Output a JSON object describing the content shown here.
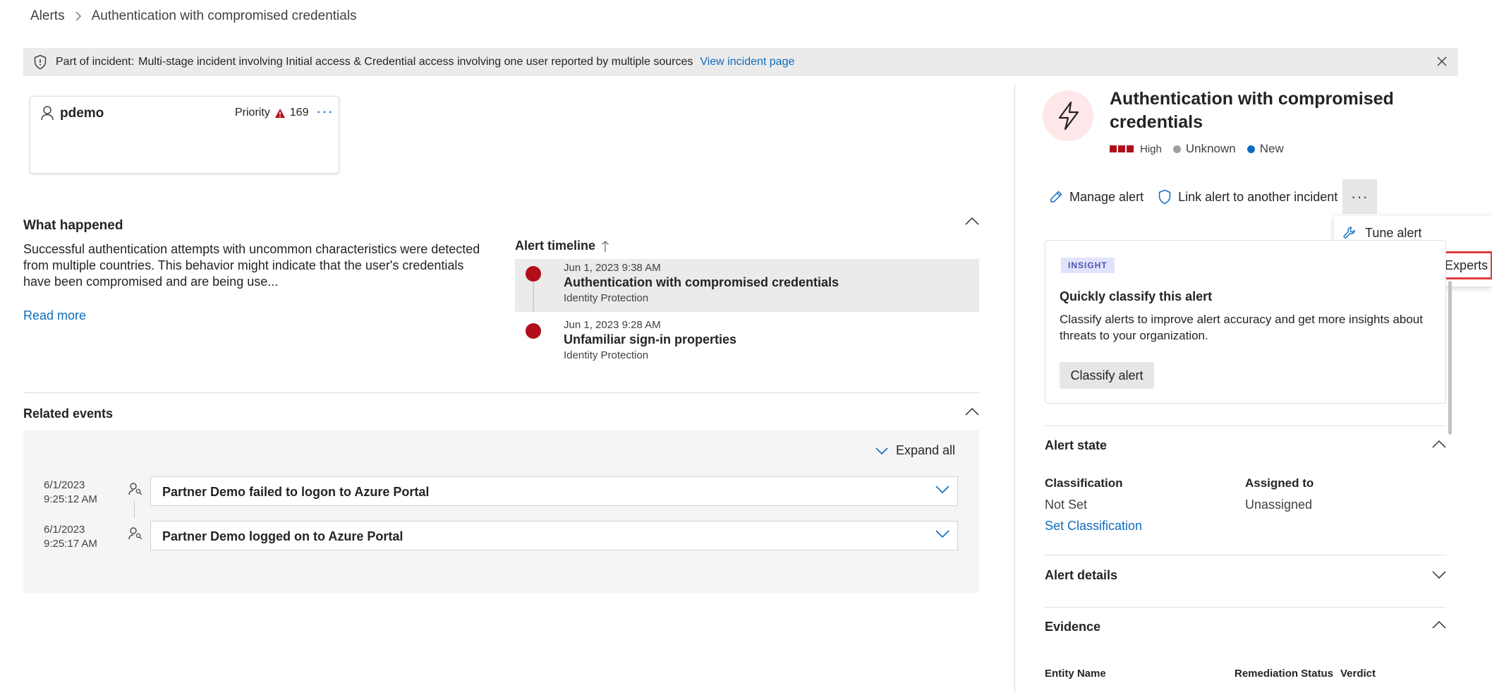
{
  "breadcrumb": {
    "root": "Alerts",
    "current": "Authentication with compromised credentials"
  },
  "banner": {
    "label": "Part of incident:",
    "description": "Multi-stage incident involving Initial access & Credential access involving one user reported by multiple sources",
    "link": "View incident page"
  },
  "user_card": {
    "name": "pdemo",
    "priority_label": "Priority",
    "priority_value": "169"
  },
  "what_happened": {
    "title": "What happened",
    "text": "Successful authentication attempts with uncommon characteristics were detected from multiple countries. This behavior might indicate that the user's credentials have been compromised and are being use...",
    "read_more": "Read more"
  },
  "timeline": {
    "title": "Alert timeline",
    "items": [
      {
        "date": "Jun 1, 2023 9:38 AM",
        "name": "Authentication with compromised credentials",
        "source": "Identity Protection"
      },
      {
        "date": "Jun 1, 2023 9:28 AM",
        "name": "Unfamiliar sign-in properties",
        "source": "Identity Protection"
      }
    ]
  },
  "related_events": {
    "title": "Related events",
    "expand_all": "Expand all",
    "events": [
      {
        "date": "6/1/2023",
        "time": "9:25:12 AM",
        "title": "Partner Demo failed to logon to Azure Portal"
      },
      {
        "date": "6/1/2023",
        "time": "9:25:17 AM",
        "title": "Partner Demo logged on to Azure Portal"
      }
    ]
  },
  "alert": {
    "title": "Authentication with compromised credentials",
    "severity": "High",
    "status_1": "Unknown",
    "status_2": "New",
    "severity_color": "#b10e1c",
    "status_1_color": "#a19f9d",
    "status_2_color": "#0f6cbd"
  },
  "actions": {
    "manage": "Manage alert",
    "link": "Link alert to another incident"
  },
  "menu": {
    "tune": "Tune alert",
    "ask": "Ask Defender Experts"
  },
  "insight": {
    "badge": "INSIGHT",
    "heading": "Quickly classify this alert",
    "text": "Classify alerts to improve alert accuracy and get more insights about threats to your organization.",
    "button": "Classify alert"
  },
  "alert_state": {
    "title": "Alert state",
    "classification_label": "Classification",
    "classification_value": "Not Set",
    "set_classification": "Set Classification",
    "assigned_label": "Assigned to",
    "assigned_value": "Unassigned"
  },
  "alert_details": {
    "title": "Alert details"
  },
  "evidence": {
    "title": "Evidence",
    "columns": [
      "Entity Name",
      "Remediation Status",
      "Verdict"
    ]
  }
}
